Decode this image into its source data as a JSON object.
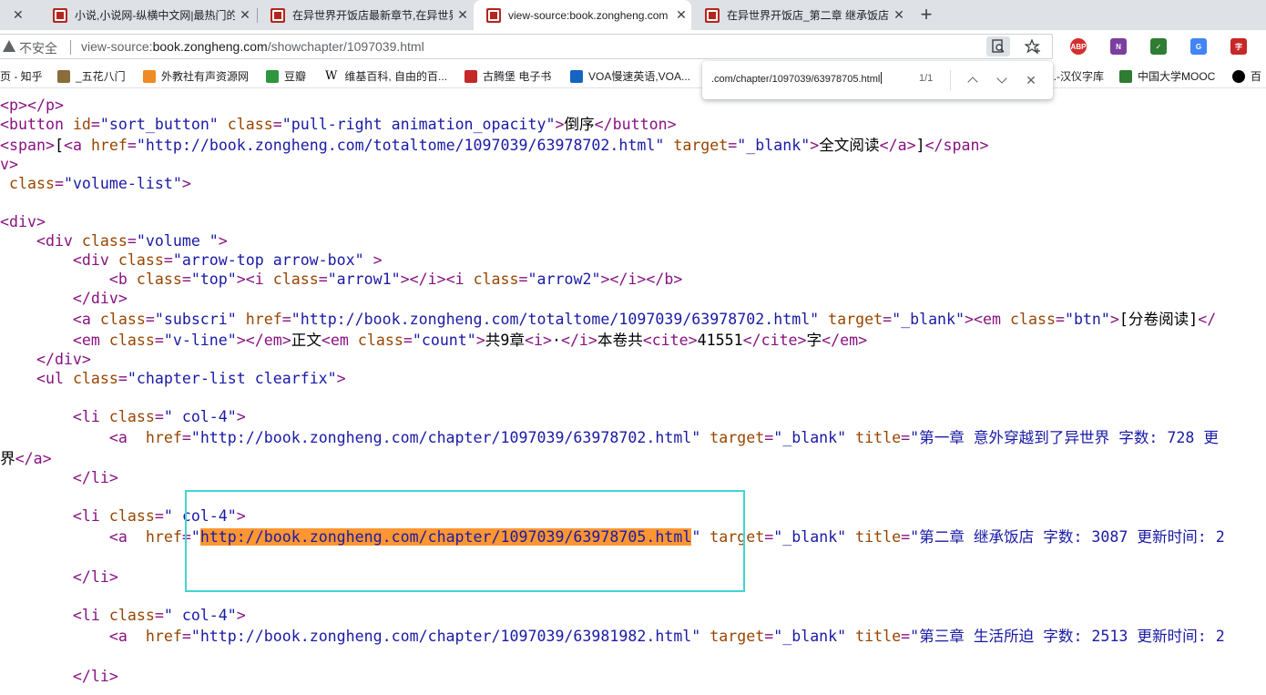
{
  "tabs": [
    {
      "title": "小说,小说网-纵横中文网|最热门的",
      "active": false
    },
    {
      "title": "在异世界开饭店最新章节,在异世界",
      "active": false
    },
    {
      "title": "view-source:book.zongheng.com",
      "active": true
    },
    {
      "title": "在异世界开饭店_第二章 继承饭店",
      "active": false
    }
  ],
  "addressbar": {
    "security_label": "不安全",
    "url_prefix": "view-source:",
    "url_host": "book.zongheng.com",
    "url_path": "/showchapter/1097039.html"
  },
  "bookmarks": [
    {
      "label": "页 - 知乎",
      "color": ""
    },
    {
      "label": "_五花八门",
      "color": "#8a6d3b"
    },
    {
      "label": "外教社有声资源网",
      "color": "#f08a24"
    },
    {
      "label": "豆瓣",
      "color": "#2e963d"
    },
    {
      "label": "维基百科, 自由的百...",
      "color": ""
    },
    {
      "label": "古腾堡 电子书",
      "color": "#c62828"
    },
    {
      "label": "VOA慢速英语,VOA...",
      "color": "#1565c0"
    },
    {
      "label": "...-汉仪字库",
      "color": ""
    },
    {
      "label": "中国大学MOOC",
      "color": "#2e7d32"
    },
    {
      "label": "百",
      "color": "#000000"
    }
  ],
  "findbar": {
    "query": ".com/chapter/1097039/63978705.html",
    "count": "1/1"
  },
  "source": {
    "l1_tag": "<p></p>",
    "l2_open": "<button ",
    "l2_an1": "id",
    "l2_av1": "\"sort_button\"",
    "l2_an2": " class",
    "l2_av2": "\"pull-right animation_opacity\"",
    "l2_close": ">",
    "l2_text": "倒序",
    "l2_end": "</button>",
    "l3_open": "<span>",
    "l3_text1": "[",
    "l3_a_open": "<a ",
    "l3_an1": "href",
    "l3_av1": "\"http://book.zongheng.com/totaltome/1097039/63978702.html\"",
    "l3_an2": " target",
    "l3_av2": "\"_blank\"",
    "l3_a_close": ">",
    "l3_text2": "全文阅读",
    "l3_a_end": "</a>",
    "l3_text3": "]",
    "l3_end": "</span>",
    "l4_tag": "v>",
    "l5_an": " class",
    "l5_av": "\"volume-list\"",
    "l5_close": ">",
    "l6_tag": "<div>",
    "l7_open": "    <div ",
    "l7_an": "class",
    "l7_av": "\"volume \"",
    "l7_close": ">",
    "l8_open": "        <div ",
    "l8_an": "class",
    "l8_av": "\"arrow-top arrow-box\"",
    "l8_close": " >",
    "l9_b": "            <b ",
    "l9_an1": "class",
    "l9_av1": "\"top\"",
    "l9_i1": "><i ",
    "l9_an2": "class",
    "l9_av2": "\"arrow1\"",
    "l9_i1e": "></i><i ",
    "l9_an3": "class",
    "l9_av3": "\"arrow2\"",
    "l9_end": "></i></b>",
    "l10_tag": "        </div>",
    "l11_open": "        <a ",
    "l11_an1": "class",
    "l11_av1": "\"subscri\"",
    "l11_an2": " href",
    "l11_av2": "\"http://book.zongheng.com/totaltome/1097039/63978702.html\"",
    "l11_an3": " target",
    "l11_av3": "\"_blank\"",
    "l11_em": "><em ",
    "l11_an4": "class",
    "l11_av4": "\"btn\"",
    "l11_close": ">",
    "l11_text": "[分卷阅读]",
    "l11_end": "</",
    "l12_open": "        <em ",
    "l12_an1": "class",
    "l12_av1": "\"v-line\"",
    "l12_mid1": "></em>",
    "l12_text1": "正文",
    "l12_em2": "<em ",
    "l12_an2": "class",
    "l12_av2": "\"count\"",
    "l12_close2": ">",
    "l12_text2": "共9章",
    "l12_i": "<i>",
    "l12_text3": "·",
    "l12_ie": "</i>",
    "l12_text4": "本卷共",
    "l12_cite": "<cite>",
    "l12_text5": "41551",
    "l12_citee": "</cite>",
    "l12_text6": "字",
    "l12_end": "</em>",
    "l13_tag": "    </div>",
    "l14_open": "    <ul ",
    "l14_an": "class",
    "l14_av": "\"chapter-list clearfix\"",
    "l14_close": ">",
    "li_open": "        <li ",
    "li_an": "class",
    "li_av": "\" col-4\"",
    "li_close": ">",
    "li_end": "        </li>",
    "a_open": "            <a  ",
    "a_an_href": "href",
    "a_an_target": " target",
    "a_av_target": "\"_blank\"",
    "a_an_title": " title",
    "ch1_href": "\"http://book.zongheng.com/chapter/1097039/63978702.html\"",
    "ch1_title": "\"第一章 意外穿越到了异世界 字数: 728 更",
    "ch1_wrap_text": "界",
    "ch1_wrap_end": "</a>",
    "ch2_q1": "\"",
    "ch2_url": "http://book.zongheng.com/chapter/1097039/63978705.html",
    "ch2_q2": "\"",
    "ch2_title": "\"第二章 继承饭店 字数: 3087 更新时间: 2",
    "ch3_href": "\"http://book.zongheng.com/chapter/1097039/63981982.html\"",
    "ch3_title": "\"第三章 生活所迫 字数: 2513 更新时间: 2"
  }
}
